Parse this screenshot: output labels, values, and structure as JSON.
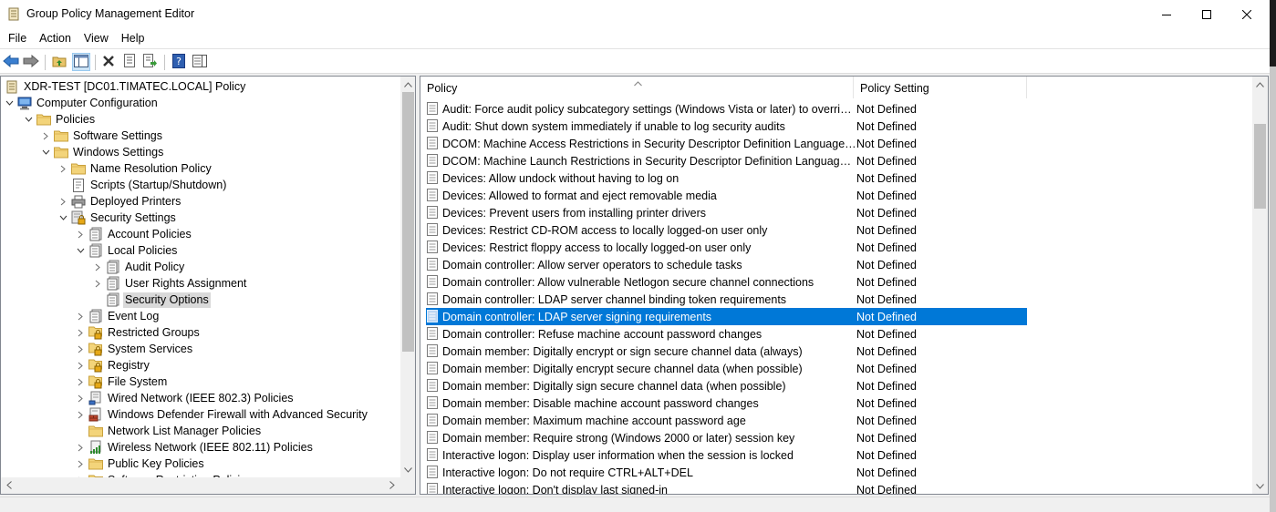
{
  "window": {
    "title": "Group Policy Management Editor",
    "icon": "gpo-editor-icon",
    "controls": [
      "minimize-icon",
      "maximize-icon",
      "close-icon"
    ]
  },
  "menu": [
    "File",
    "Action",
    "View",
    "Help"
  ],
  "toolbar": [
    "back-icon",
    "forward-icon",
    "up-folder-icon",
    "show-hide-tree-icon",
    "delete-icon",
    "properties-icon",
    "export-list-icon",
    "help-icon",
    "show-action-pane-icon"
  ],
  "tree": [
    {
      "label": "XDR-TEST [DC01.TIMATEC.LOCAL] Policy",
      "level": 0,
      "expander": "none",
      "icon": "policy-scroll-icon"
    },
    {
      "label": "Computer Configuration",
      "level": 0,
      "expander": "open",
      "icon": "computer-icon"
    },
    {
      "label": "Policies",
      "level": 1,
      "expander": "open",
      "icon": "folder-icon"
    },
    {
      "label": "Software Settings",
      "level": 2,
      "expander": "closed",
      "icon": "folder-icon"
    },
    {
      "label": "Windows Settings",
      "level": 2,
      "expander": "open",
      "icon": "folder-icon"
    },
    {
      "label": "Name Resolution Policy",
      "level": 3,
      "expander": "closed",
      "icon": "folder-icon"
    },
    {
      "label": "Scripts (Startup/Shutdown)",
      "level": 3,
      "expander": "none",
      "icon": "scripts-icon"
    },
    {
      "label": "Deployed Printers",
      "level": 3,
      "expander": "closed",
      "icon": "printer-icon"
    },
    {
      "label": "Security Settings",
      "level": 3,
      "expander": "open",
      "icon": "security-settings-icon"
    },
    {
      "label": "Account Policies",
      "level": 4,
      "expander": "closed",
      "icon": "policy-book-icon"
    },
    {
      "label": "Local Policies",
      "level": 4,
      "expander": "open",
      "icon": "policy-book-icon"
    },
    {
      "label": "Audit Policy",
      "level": 5,
      "expander": "closed",
      "icon": "policy-book-icon"
    },
    {
      "label": "User Rights Assignment",
      "level": 5,
      "expander": "closed",
      "icon": "policy-book-icon"
    },
    {
      "label": "Security Options",
      "level": 5,
      "expander": "none",
      "icon": "policy-book-icon",
      "selected": true
    },
    {
      "label": "Event Log",
      "level": 4,
      "expander": "closed",
      "icon": "policy-book-icon"
    },
    {
      "label": "Restricted Groups",
      "level": 4,
      "expander": "closed",
      "icon": "locked-folder-icon"
    },
    {
      "label": "System Services",
      "level": 4,
      "expander": "closed",
      "icon": "locked-folder-icon"
    },
    {
      "label": "Registry",
      "level": 4,
      "expander": "closed",
      "icon": "locked-folder-icon"
    },
    {
      "label": "File System",
      "level": 4,
      "expander": "closed",
      "icon": "locked-folder-icon"
    },
    {
      "label": "Wired Network (IEEE 802.3) Policies",
      "level": 4,
      "expander": "closed",
      "icon": "network-icon"
    },
    {
      "label": "Windows Defender Firewall with Advanced Security",
      "level": 4,
      "expander": "closed",
      "icon": "firewall-icon"
    },
    {
      "label": "Network List Manager Policies",
      "level": 4,
      "expander": "none",
      "icon": "folder-icon"
    },
    {
      "label": "Wireless Network (IEEE 802.11) Policies",
      "level": 4,
      "expander": "closed",
      "icon": "wireless-icon"
    },
    {
      "label": "Public Key Policies",
      "level": 4,
      "expander": "closed",
      "icon": "folder-icon"
    },
    {
      "label": "Software Restriction Policies",
      "level": 4,
      "expander": "closed",
      "icon": "folder-icon"
    }
  ],
  "list": {
    "columns": [
      "Policy",
      "Policy Setting"
    ],
    "sort_column": "Policy",
    "rows": [
      {
        "policy": "Audit: Force audit policy subcategory settings (Windows Vista or later) to override audit policy category settings",
        "setting": "Not Defined"
      },
      {
        "policy": "Audit: Shut down system immediately if unable to log security audits",
        "setting": "Not Defined"
      },
      {
        "policy": "DCOM: Machine Access Restrictions in Security Descriptor Definition Language (SDDL) syntax",
        "setting": "Not Defined"
      },
      {
        "policy": "DCOM: Machine Launch Restrictions in Security Descriptor Definition Language (SDDL) syntax",
        "setting": "Not Defined"
      },
      {
        "policy": "Devices: Allow undock without having to log on",
        "setting": "Not Defined"
      },
      {
        "policy": "Devices: Allowed to format and eject removable media",
        "setting": "Not Defined"
      },
      {
        "policy": "Devices: Prevent users from installing printer drivers",
        "setting": "Not Defined"
      },
      {
        "policy": "Devices: Restrict CD-ROM access to locally logged-on user only",
        "setting": "Not Defined"
      },
      {
        "policy": "Devices: Restrict floppy access to locally logged-on user only",
        "setting": "Not Defined"
      },
      {
        "policy": "Domain controller: Allow server operators to schedule tasks",
        "setting": "Not Defined"
      },
      {
        "policy": "Domain controller: Allow vulnerable Netlogon secure channel connections",
        "setting": "Not Defined"
      },
      {
        "policy": "Domain controller: LDAP server channel binding token requirements",
        "setting": "Not Defined"
      },
      {
        "policy": "Domain controller: LDAP server signing requirements",
        "setting": "Not Defined",
        "selected": true
      },
      {
        "policy": "Domain controller: Refuse machine account password changes",
        "setting": "Not Defined"
      },
      {
        "policy": "Domain member: Digitally encrypt or sign secure channel data (always)",
        "setting": "Not Defined"
      },
      {
        "policy": "Domain member: Digitally encrypt secure channel data (when possible)",
        "setting": "Not Defined"
      },
      {
        "policy": "Domain member: Digitally sign secure channel data (when possible)",
        "setting": "Not Defined"
      },
      {
        "policy": "Domain member: Disable machine account password changes",
        "setting": "Not Defined"
      },
      {
        "policy": "Domain member: Maximum machine account password age",
        "setting": "Not Defined"
      },
      {
        "policy": "Domain member: Require strong (Windows 2000 or later) session key",
        "setting": "Not Defined"
      },
      {
        "policy": "Interactive logon: Display user information when the session is locked",
        "setting": "Not Defined"
      },
      {
        "policy": "Interactive logon: Do not require CTRL+ALT+DEL",
        "setting": "Not Defined"
      },
      {
        "policy": "Interactive logon: Don't display last signed-in",
        "setting": "Not Defined"
      }
    ]
  },
  "colors": {
    "selection": "#0078d7",
    "tree_selection": "#d9d9d9",
    "pane_border": "#828790"
  }
}
